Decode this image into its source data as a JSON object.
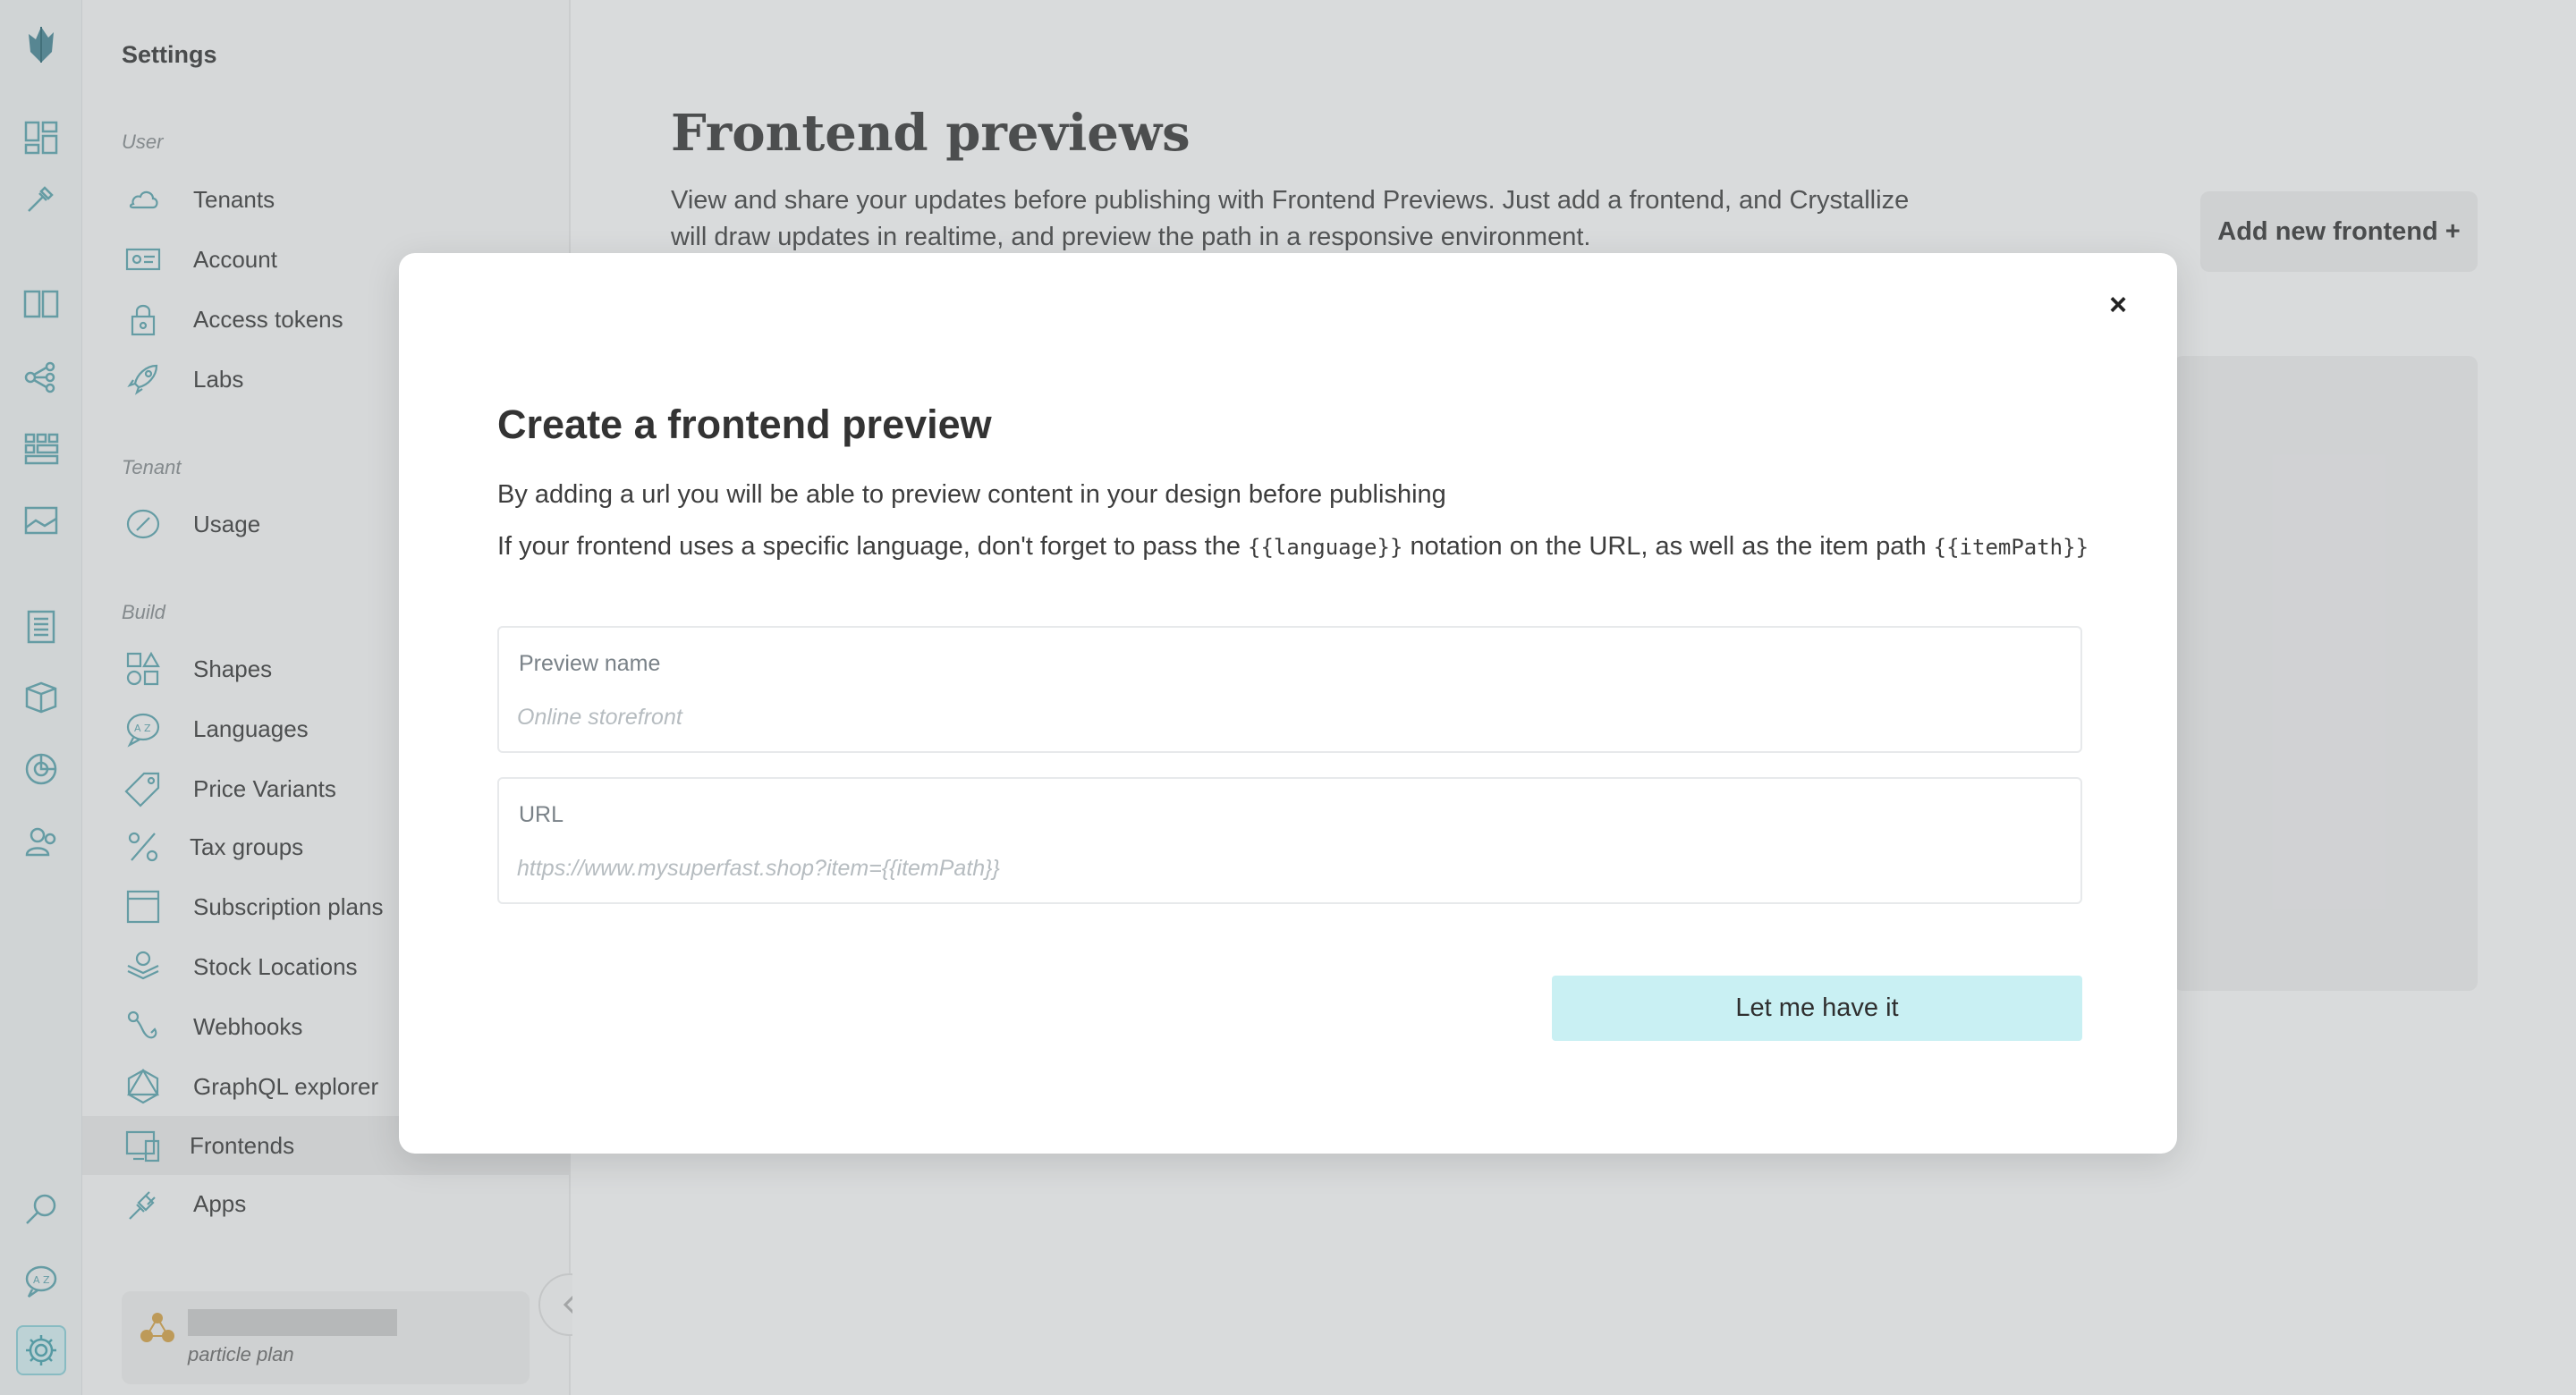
{
  "colors": {
    "accent": "#4aa5b0",
    "accent_light": "#c9f0f3",
    "icon_stroke": "#5fa8b2"
  },
  "rail": {
    "icons": [
      "crystallize-logo-icon",
      "dashboard-icon",
      "pipette-icon",
      "catalogue-book-icon",
      "topology-icon",
      "grid-icon",
      "image-icon",
      "orders-clipboard-icon",
      "box-icon",
      "chart-icon",
      "customers-icon",
      "search-icon",
      "languages-icon",
      "settings-gear-icon"
    ]
  },
  "sidebar": {
    "title": "Settings",
    "sections": {
      "user": "User",
      "tenant": "Tenant",
      "build": "Build"
    },
    "items": [
      {
        "label": "Tenants",
        "icon": "cloud-icon"
      },
      {
        "label": "Account",
        "icon": "id-card-icon"
      },
      {
        "label": "Access tokens",
        "icon": "lock-icon"
      },
      {
        "label": "Labs",
        "icon": "rocket-icon"
      },
      {
        "label": "Usage",
        "icon": "gauge-icon"
      },
      {
        "label": "Shapes",
        "icon": "shapes-icon"
      },
      {
        "label": "Languages",
        "icon": "languages-icon"
      },
      {
        "label": "Price Variants",
        "icon": "price-tag-icon"
      },
      {
        "label": "Tax groups",
        "icon": "percent-icon"
      },
      {
        "label": "Subscription plans",
        "icon": "calendar-icon"
      },
      {
        "label": "Stock Locations",
        "icon": "stock-icon"
      },
      {
        "label": "Webhooks",
        "icon": "webhook-icon"
      },
      {
        "label": "GraphQL explorer",
        "icon": "graphql-icon"
      },
      {
        "label": "Frontends",
        "icon": "frontends-icon"
      },
      {
        "label": "Apps",
        "icon": "plug-icon"
      }
    ],
    "plan": "particle plan"
  },
  "main": {
    "title": "Frontend previews",
    "description": "View and share your updates before publishing with Frontend Previews. Just add a frontend, and Crystallize will draw updates in realtime, and preview the path in a responsive environment.",
    "add_button": "Add new frontend +"
  },
  "modal": {
    "close": "×",
    "title": "Create a frontend preview",
    "intro": "By adding a url you will be able to preview content in your design before publishing",
    "note_part1": "If your frontend uses a specific language, don't forget to pass the ",
    "note_code1": "{{language}}",
    "note_part2": " notation on the URL, as well as the item path ",
    "note_code2": "{{itemPath}}",
    "fields": {
      "name_label": "Preview name",
      "name_placeholder": "Online storefront",
      "url_label": "URL",
      "url_placeholder": "https://www.mysuperfast.shop?item={{itemPath}}"
    },
    "submit": "Let me have it"
  }
}
